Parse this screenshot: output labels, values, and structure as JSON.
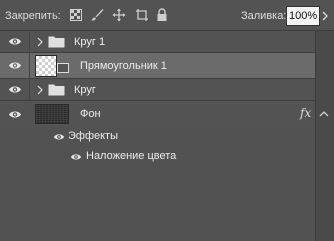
{
  "toolbar": {
    "lock_label": "Закрепить:",
    "fill_label": "Заливка:",
    "fill_value": "100%",
    "icons": [
      "lock-transparent-pixels-icon",
      "lock-image-pixels-icon",
      "lock-position-icon",
      "artboard-autonest-icon",
      "lock-all-icon"
    ]
  },
  "layers": [
    {
      "name": "Круг 1",
      "kind": "group",
      "visible": true,
      "collapsed": true
    },
    {
      "name": "Прямоугольник 1",
      "kind": "shape",
      "visible": true,
      "selected": true
    },
    {
      "name": "Круг",
      "kind": "group",
      "visible": true,
      "collapsed": true
    },
    {
      "name": "Фон",
      "kind": "background",
      "visible": true,
      "fx": "fx",
      "effects_label": "Эффекты",
      "effects": [
        "Наложение цвета"
      ]
    }
  ],
  "colors": {
    "panel_bg": "#535353",
    "selected_row": "#6b6b6b",
    "text": "#ececec"
  }
}
